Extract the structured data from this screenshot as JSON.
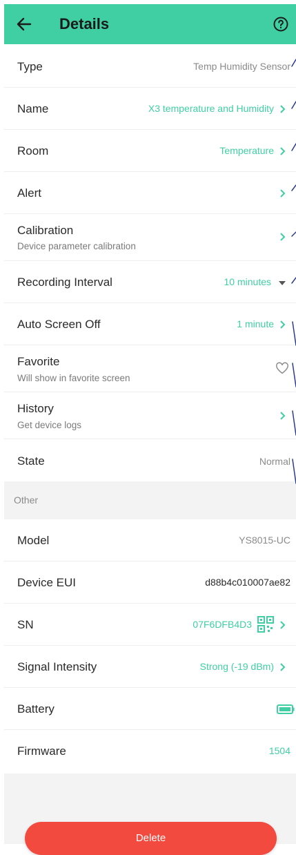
{
  "header": {
    "title": "Details"
  },
  "rows": {
    "type": {
      "label": "Type",
      "value": "Temp Humidity Sensor"
    },
    "name": {
      "label": "Name",
      "value": "X3 temperature and Humidity"
    },
    "room": {
      "label": "Room",
      "value": "Temperature"
    },
    "alert": {
      "label": "Alert"
    },
    "calibration": {
      "label": "Calibration",
      "sub": "Device parameter calibration"
    },
    "recording": {
      "label": "Recording Interval",
      "value": "10 minutes"
    },
    "screen_off": {
      "label": "Auto Screen Off",
      "value": "1 minute"
    },
    "favorite": {
      "label": "Favorite",
      "sub": "Will show in favorite screen"
    },
    "history": {
      "label": "History",
      "sub": "Get device logs"
    },
    "state": {
      "label": "State",
      "value": "Normal"
    }
  },
  "section_other": {
    "label": "Other"
  },
  "other_rows": {
    "model": {
      "label": "Model",
      "value": "YS8015-UC"
    },
    "eui": {
      "label": "Device EUI",
      "value": "d88b4c010007ae82"
    },
    "sn": {
      "label": "SN",
      "value": "07F6DFB4D3"
    },
    "signal": {
      "label": "Signal Intensity",
      "value": "Strong (-19 dBm)"
    },
    "battery": {
      "label": "Battery"
    },
    "firmware": {
      "label": "Firmware",
      "value": "1504"
    }
  },
  "delete_label": "Delete",
  "colors": {
    "accent": "#3fcfa2",
    "danger": "#f24a3f",
    "section_bg": "#f3f3f3"
  }
}
